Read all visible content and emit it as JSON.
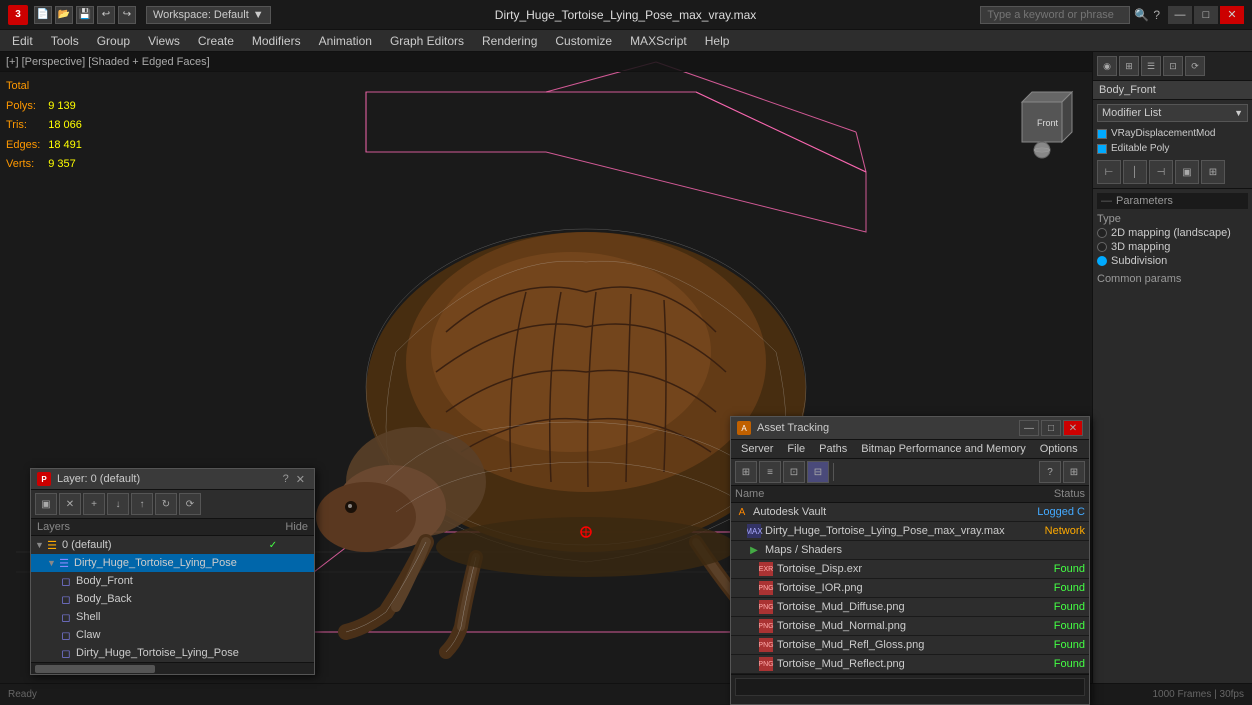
{
  "titlebar": {
    "file_name": "Dirty_Huge_Tortoise_Lying_Pose_max_vray.max",
    "workspace": "Workspace: Default",
    "search_placeholder": "Type a keyword or phrase",
    "min_label": "—",
    "max_label": "□",
    "close_label": "✕"
  },
  "menubar": {
    "items": [
      {
        "id": "edit",
        "label": "Edit"
      },
      {
        "id": "tools",
        "label": "Tools"
      },
      {
        "id": "group",
        "label": "Group"
      },
      {
        "id": "views",
        "label": "Views"
      },
      {
        "id": "create",
        "label": "Create"
      },
      {
        "id": "modifiers",
        "label": "Modifiers"
      },
      {
        "id": "animation",
        "label": "Animation"
      },
      {
        "id": "graph-editors",
        "label": "Graph Editors"
      },
      {
        "id": "rendering",
        "label": "Rendering"
      },
      {
        "id": "customize",
        "label": "Customize"
      },
      {
        "id": "maxscript",
        "label": "MAXScript"
      },
      {
        "id": "help",
        "label": "Help"
      }
    ]
  },
  "viewport": {
    "label": "[+] [Perspective] [Shaded + Edged Faces]",
    "stats": {
      "header": "Total",
      "polys_label": "Polys:",
      "polys_value": "9 139",
      "tris_label": "Tris:",
      "tris_value": "18 066",
      "edges_label": "Edges:",
      "edges_value": "18 491",
      "verts_label": "Verts:",
      "verts_value": "9 357"
    }
  },
  "right_panel": {
    "object_name": "Body_Front",
    "modifier_list_label": "Modifier List",
    "modifiers": [
      {
        "name": "VRayDisplacementMod",
        "enabled": true
      },
      {
        "name": "Editable Poly",
        "enabled": true
      }
    ],
    "toolbar_icons": [
      "⊢",
      "│",
      "⊣",
      "▣",
      "⊞"
    ],
    "parameters": {
      "header": "Parameters",
      "type_label": "Type",
      "options": [
        {
          "label": "2D mapping (landscape)",
          "selected": false
        },
        {
          "label": "3D mapping",
          "selected": false
        },
        {
          "label": "Subdivision",
          "selected": true
        }
      ],
      "common_params_label": "Common params"
    }
  },
  "layer_panel": {
    "title": "Layer: 0 (default)",
    "close_label": "✕",
    "help_label": "?",
    "toolbar_buttons": [
      "▣",
      "✕",
      "+",
      "↓",
      "↑",
      "↻",
      "⟳"
    ],
    "header": {
      "name_label": "Layers",
      "hide_label": "Hide"
    },
    "items": [
      {
        "id": "default",
        "name": "0 (default)",
        "indent": 0,
        "checked": true,
        "expand": false,
        "icon": "layer"
      },
      {
        "id": "lying-pose",
        "name": "Dirty_Huge_Tortoise_Lying_Pose",
        "indent": 1,
        "checked": false,
        "expand": true,
        "icon": "layer",
        "selected": true
      },
      {
        "id": "body-front",
        "name": "Body_Front",
        "indent": 2,
        "checked": false,
        "expand": false,
        "icon": "object"
      },
      {
        "id": "body-back",
        "name": "Body_Back",
        "indent": 2,
        "checked": false,
        "expand": false,
        "icon": "object"
      },
      {
        "id": "shell",
        "name": "Shell",
        "indent": 2,
        "checked": false,
        "expand": false,
        "icon": "object"
      },
      {
        "id": "claw",
        "name": "Claw",
        "indent": 2,
        "checked": false,
        "expand": false,
        "icon": "object"
      },
      {
        "id": "dirty-pose",
        "name": "Dirty_Huge_Tortoise_Lying_Pose",
        "indent": 2,
        "checked": false,
        "expand": false,
        "icon": "object"
      }
    ]
  },
  "asset_panel": {
    "title": "Asset Tracking",
    "menu": [
      "Server",
      "File",
      "Paths",
      "Bitmap Performance and Memory",
      "Options"
    ],
    "toolbar_buttons": [
      "⊞",
      "≡",
      "⊡",
      "⊟"
    ],
    "table_headers": {
      "name": "Name",
      "status": "Status"
    },
    "items": [
      {
        "id": "autodesk",
        "name": "Autodesk Vault",
        "indent": 0,
        "icon": "autodesk",
        "status": "Logged C",
        "status_type": "logged"
      },
      {
        "id": "max-file",
        "name": "Dirty_Huge_Tortoise_Lying_Pose_max_vray.max",
        "indent": 1,
        "icon": "max",
        "status": "Network",
        "status_type": "network"
      },
      {
        "id": "maps",
        "name": "Maps / Shaders",
        "indent": 1,
        "icon": "folder",
        "status": "",
        "status_type": ""
      },
      {
        "id": "disp",
        "name": "Tortoise_Disp.exr",
        "indent": 2,
        "icon": "png",
        "status": "Found",
        "status_type": "found"
      },
      {
        "id": "ior",
        "name": "Tortoise_IOR.png",
        "indent": 2,
        "icon": "png",
        "status": "Found",
        "status_type": "found"
      },
      {
        "id": "diffuse",
        "name": "Tortoise_Mud_Diffuse.png",
        "indent": 2,
        "icon": "png",
        "status": "Found",
        "status_type": "found"
      },
      {
        "id": "normal",
        "name": "Tortoise_Mud_Normal.png",
        "indent": 2,
        "icon": "png",
        "status": "Found",
        "status_type": "found"
      },
      {
        "id": "refl",
        "name": "Tortoise_Mud_Refl_Gloss.png",
        "indent": 2,
        "icon": "png",
        "status": "Found",
        "status_type": "found"
      },
      {
        "id": "reflect",
        "name": "Tortoise_Mud_Reflect.png",
        "indent": 2,
        "icon": "png",
        "status": "Found",
        "status_type": "found"
      }
    ]
  },
  "icons": {
    "png_label": "PNG",
    "max_label": "MAX",
    "folder_label": "📁",
    "autodesk_label": "A"
  }
}
